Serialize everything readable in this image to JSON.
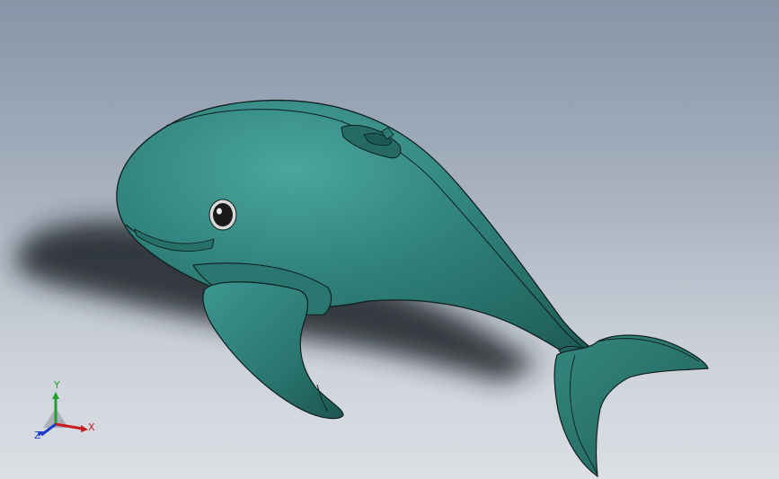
{
  "viewport": {
    "background_top": "#8795a8",
    "background_bottom": "#dcdfe4"
  },
  "model": {
    "body_color": "#2f7f78",
    "body_highlight": "#3f9a92",
    "body_shadow": "#1f5e59",
    "edge_color": "#0e1f1e"
  },
  "triad": {
    "x_label": "X",
    "y_label": "Y",
    "z_label": "Z",
    "x_color": "#c81e1e",
    "y_color": "#21a02a",
    "z_color": "#1e3cc8"
  }
}
